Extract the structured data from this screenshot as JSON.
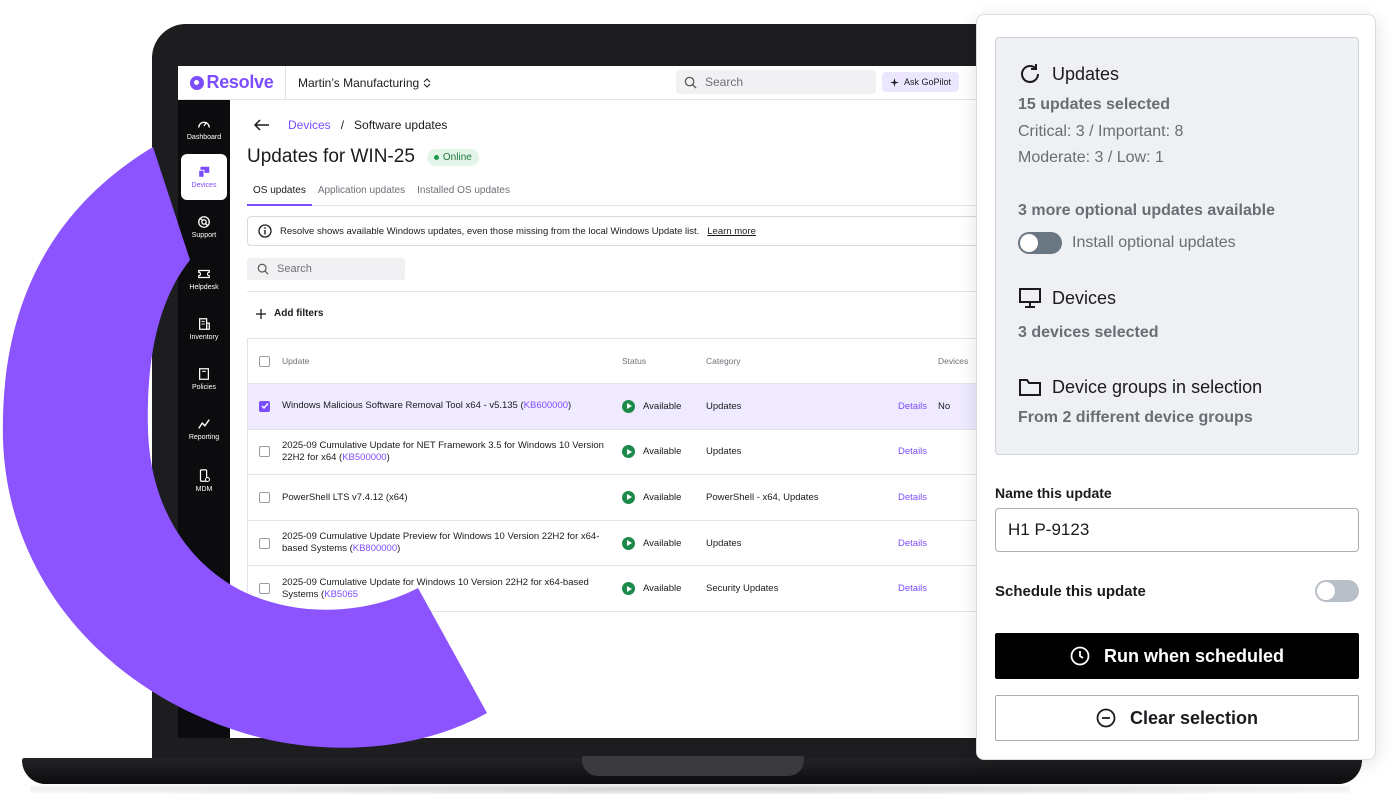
{
  "topbar": {
    "logo": "Resolve",
    "org": "Martin’s Manufacturing",
    "search_placeholder": "Search",
    "gopilot": "Ask GoPilot"
  },
  "sidebar": {
    "items": [
      {
        "label": "Dashboard",
        "icon": "gauge-icon"
      },
      {
        "label": "Devices",
        "icon": "devices-icon"
      },
      {
        "label": "Support",
        "icon": "lifebuoy-icon"
      },
      {
        "label": "Helpdesk",
        "icon": "ticket-icon"
      },
      {
        "label": "Inventory",
        "icon": "building-icon"
      },
      {
        "label": "Policies",
        "icon": "book-icon"
      },
      {
        "label": "Reporting",
        "icon": "chart-line-icon"
      },
      {
        "label": "MDM",
        "icon": "phone-gear-icon"
      }
    ]
  },
  "main": {
    "breadcrumb_link": "Devices",
    "breadcrumb_sep": "/",
    "breadcrumb_current": "Software updates",
    "title": "Updates for WIN-25",
    "status_badge": "Online",
    "tabs": [
      "OS updates",
      "Application updates",
      "Installed OS updates"
    ],
    "info_text": "Resolve shows available Windows updates, even those missing from the local Windows Update list.",
    "info_link": "Learn more",
    "search_placeholder": "Search",
    "add_filters": "Add filters",
    "table": {
      "headers": {
        "update": "Update",
        "status": "Status",
        "category": "Category",
        "devices": "Devices"
      },
      "rows": [
        {
          "text": "Windows Malicious Software Removal Tool x64 - v5.135 (",
          "kb": "KB600000",
          "tail": ")",
          "status": "Available",
          "category": "Updates",
          "details": "Details",
          "devices": "No",
          "selected": true
        },
        {
          "text": "2025-09 Cumulative Update for NET Framework 3.5 for Windows 10 Version 22H2 for x64 (",
          "kb": "KB500000",
          "tail": ")",
          "status": "Available",
          "category": "Updates",
          "details": "Details",
          "devices": "",
          "selected": false
        },
        {
          "text": "PowerShell LTS v7.4.12 (x64)",
          "kb": "",
          "tail": "",
          "status": "Available",
          "category": "PowerShell - x64, Updates",
          "details": "Details",
          "devices": "",
          "selected": false
        },
        {
          "text": "2025-09 Cumulative Update Preview for Windows 10 Version 22H2 for x64-based Systems (",
          "kb": "KB800000",
          "tail": ")",
          "status": "Available",
          "category": "Updates",
          "details": "Details",
          "devices": "",
          "selected": false
        },
        {
          "text": "2025-09 Cumulative Update for Windows 10 Version 22H2 for x64-based Systems (",
          "kb": "KB5065",
          "tail": "",
          "status": "Available",
          "category": "Security Updates",
          "details": "Details",
          "devices": "",
          "selected": false
        }
      ]
    }
  },
  "panel": {
    "updates_heading": "Updates",
    "updates_selected": "15 updates selected",
    "severity_line1": "Critical: 3 / Important: 8",
    "severity_line2": "Moderate: 3 / Low: 1",
    "optional_available": "3 more optional updates available",
    "install_optional_label": "Install optional updates",
    "devices_heading": "Devices",
    "devices_selected": "3 devices selected",
    "groups_heading": "Device groups in selection",
    "groups_text": "From 2 different device groups",
    "name_label": "Name this update",
    "name_value": "H1 P-9123",
    "schedule_label": "Schedule this update",
    "run_button": "Run when scheduled",
    "clear_button": "Clear selection"
  },
  "colors": {
    "brand": "#7c4dff",
    "available": "#1e8a4a",
    "arc": "#8b54ff"
  }
}
